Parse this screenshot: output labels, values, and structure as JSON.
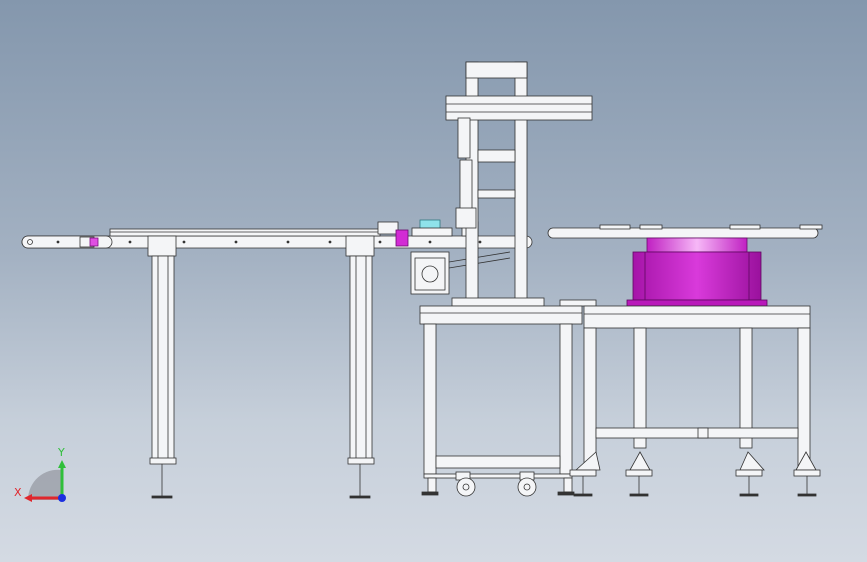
{
  "viewport": {
    "background_top": "#8497ad",
    "background_bottom": "#d4dae3"
  },
  "colors": {
    "frame_fill": "#f4f5f7",
    "frame_stroke": "#333333",
    "magenta": "#c21dc4",
    "magenta_dark": "#8d0f90",
    "magenta_light": "#ee7af0",
    "cyan": "#8fe3ea",
    "axis_x": "#e0262c",
    "axis_y": "#2fbf3a",
    "axis_z": "#1b2fe0"
  },
  "triad": {
    "x_label": "X",
    "y_label": "Y"
  }
}
